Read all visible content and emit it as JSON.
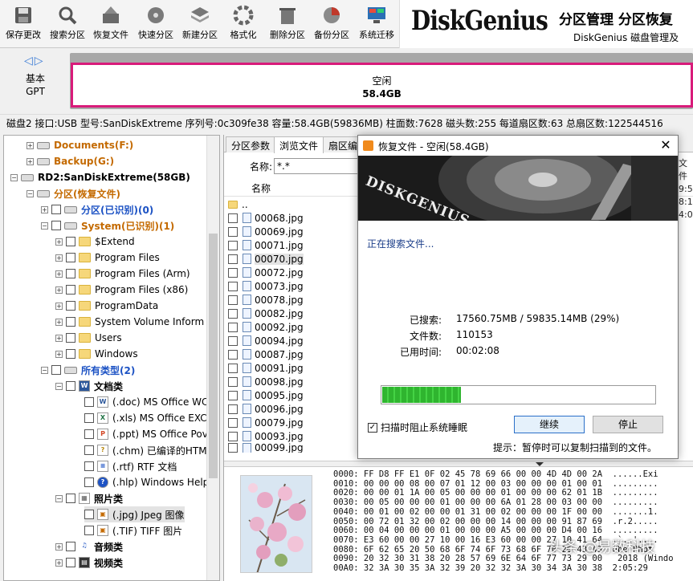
{
  "toolbar": {
    "buttons": [
      "保存更改",
      "搜索分区",
      "恢复文件",
      "快速分区",
      "新建分区",
      "格式化",
      "删除分区",
      "备份分区",
      "系统迁移"
    ],
    "brand": "DiskGenius",
    "banner_title": "分区管理 分区恢复",
    "banner_sub": "DiskGenius 磁盘管理及"
  },
  "diskbar": {
    "nav": "◁▷",
    "disk_type_line1": "基本",
    "disk_type_line2": "GPT",
    "part_label": "空闲",
    "part_size": "58.4GB"
  },
  "disk_info": "磁盘2 接口:USB  型号:SanDiskExtreme  序列号:0c309fe38  容量:58.4GB(59836MB)  柱面数:7628  磁头数:255  每道扇区数:63  总扇区数:122544516",
  "tree": [
    {
      "label": "Documents(F:)",
      "style": "orange"
    },
    {
      "label": "Backup(G:)",
      "style": "orange"
    },
    {
      "label": "RD2:SanDiskExtreme(58GB)",
      "style": "bold"
    },
    {
      "label": "分区(恢复文件)",
      "style": "orange"
    },
    {
      "label": "分区(已识别)(0)",
      "style": "blue"
    },
    {
      "label": "System(已识别)(1)",
      "style": "orange"
    },
    {
      "label": "$Extend",
      "style": ""
    },
    {
      "label": "Program Files",
      "style": ""
    },
    {
      "label": "Program Files (Arm)",
      "style": ""
    },
    {
      "label": "Program Files (x86)",
      "style": ""
    },
    {
      "label": "ProgramData",
      "style": ""
    },
    {
      "label": "System Volume Inform",
      "style": ""
    },
    {
      "label": "Users",
      "style": ""
    },
    {
      "label": "Windows",
      "style": ""
    },
    {
      "label": "所有类型(2)",
      "style": "blue"
    },
    {
      "label": "文档类",
      "style": "bold"
    },
    {
      "label": "(.doc) MS Office WC",
      "style": ""
    },
    {
      "label": "(.xls) MS Office EXC",
      "style": ""
    },
    {
      "label": "(.ppt) MS Office Pov",
      "style": ""
    },
    {
      "label": "(.chm) 已编译的HTM",
      "style": ""
    },
    {
      "label": "(.rtf) RTF 文档",
      "style": ""
    },
    {
      "label": "(.hlp) Windows Help",
      "style": ""
    },
    {
      "label": "照片类",
      "style": "bold"
    },
    {
      "label": "(.jpg) Jpeg 图像",
      "style": ""
    },
    {
      "label": "(.TIF) TIFF 图片",
      "style": ""
    },
    {
      "label": "音频类",
      "style": "bold"
    },
    {
      "label": "视频类",
      "style": "bold"
    }
  ],
  "tabs": [
    "分区参数",
    "浏览文件",
    "扇区编辑"
  ],
  "filter": {
    "label": "名称:",
    "value": "*.*"
  },
  "file_list": {
    "column_name": "名称",
    "parent": "..",
    "files": [
      "00068.jpg",
      "00069.jpg",
      "00071.jpg",
      "00070.jpg",
      "00072.jpg",
      "00073.jpg",
      "00078.jpg",
      "00082.jpg",
      "00092.jpg",
      "00094.jpg",
      "00087.jpg",
      "00091.jpg",
      "00098.jpg",
      "00095.jpg",
      "00096.jpg",
      "00079.jpg",
      "00093.jpg",
      "00099.jpg"
    ]
  },
  "right_edge": [
    "文件",
    "",
    "",
    "",
    "9:5",
    "8:1",
    "4:0"
  ],
  "hex_lines": [
    "0000: FF D8 FF E1 0F 02 45 78 69 66 00 00 4D 4D 00 2A  ......Exi",
    "0010: 00 00 00 08 00 07 01 12 00 03 00 00 00 01 00 01  .........",
    "0020: 00 00 01 1A 00 05 00 00 00 01 00 00 00 62 01 1B  .........",
    "0030: 00 05 00 00 00 01 00 00 00 6A 01 28 00 03 00 00  .........",
    "0040: 00 01 00 02 00 00 01 31 00 02 00 00 00 1F 00 00  .......1.",
    "0050: 00 72 01 32 00 02 00 00 00 14 00 00 00 91 87 69  .r.2.....",
    "0060: 00 04 00 00 00 01 00 00 00 A5 00 00 00 D4 00 16  .........",
    "0070: E3 60 00 00 27 10 00 16 E3 60 00 00 27 10 41 64  .`..'....",
    "0080: 6F 62 65 20 50 68 6F 74 6F 73 68 6F 70 20 43 43  obe Phot",
    "0090: 20 32 30 31 38 20 28 57 69 6E 64 6F 77 73 29 00   2018 (Windo",
    "00A0: 32 3A 30 35 3A 32 39 20 32 32 3A 30 34 3A 30 38  2:05:29 "
  ],
  "dialog": {
    "title": "恢复文件 - 空闲(58.4GB)",
    "close": "✕",
    "banner_brand": "DISKGENIUS",
    "status": "正在搜索文件...",
    "searched_label": "已搜索:",
    "searched_value": "17560.75MB / 59835.14MB (29%)",
    "files_label": "文件数:",
    "files_value": "110153",
    "time_label": "已用时间:",
    "time_value": "00:02:08",
    "progress": 0.29,
    "keep_awake_label": "扫描时阻止系统睡眠",
    "keep_awake_checked": "✓",
    "continue_label": "继续",
    "stop_label": "停止",
    "hint": "提示：暂停时可以复制扫描到的文件。"
  },
  "watermark": "头条 @易数科技"
}
